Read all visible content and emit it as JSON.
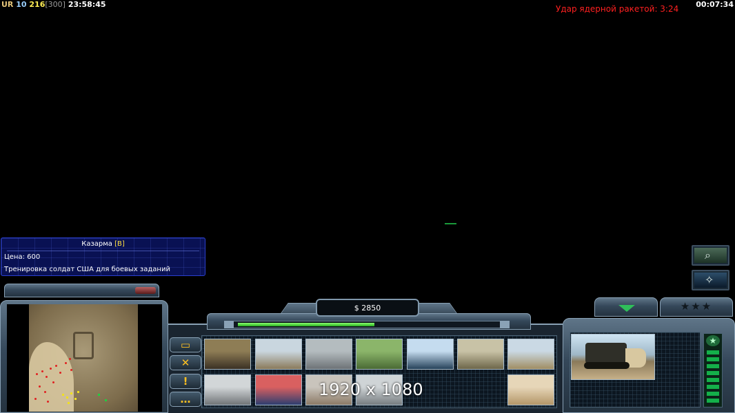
{
  "hud": {
    "faction": "UR",
    "level": "10",
    "units": "216",
    "unit_cap": "[300]",
    "clock": "23:58:45",
    "game_time": "00:07:34",
    "nuke_timer": "Удар ядерной ракетой: 3:24"
  },
  "tooltip": {
    "title": "Казарма",
    "hotkey": "[B]",
    "cost": "Цена: 600",
    "description": "Тренировка солдат США для боевых заданий"
  },
  "resources": {
    "money": "$ 2850",
    "power_level": 0.52
  },
  "overlay": {
    "resolution": "1920 x 1080"
  },
  "tabs": [
    {
      "icon": "structure-icon",
      "glyph": "▭"
    },
    {
      "icon": "tools-icon",
      "glyph": "✕"
    },
    {
      "icon": "alert-icon",
      "glyph": "!"
    },
    {
      "icon": "chat-icon",
      "glyph": "…"
    }
  ],
  "build_buttons": [
    {
      "name": "command-center-button",
      "c1": "#8e7d55",
      "c2": "#3a3024"
    },
    {
      "name": "barracks-button",
      "c1": "#c9d6df",
      "c2": "#8a7a5a"
    },
    {
      "name": "supply-center-button",
      "c1": "#b4bcbf",
      "c2": "#6d7276"
    },
    {
      "name": "airfield-button",
      "c1": "#8bb56a",
      "c2": "#4a6a35"
    },
    {
      "name": "patriot-battery-button",
      "c1": "#c5dcef",
      "c2": "#26425a"
    },
    {
      "name": "war-factory-button",
      "c1": "#c8c2a6",
      "c2": "#6d6649"
    },
    {
      "name": "strategy-center-button",
      "c1": "#cad9e4",
      "c2": "#a08d63"
    },
    {
      "name": "power-plant-button",
      "c1": "#d2d6d8",
      "c2": "#707477"
    },
    {
      "name": "fire-base-button",
      "c1": "#d96060",
      "c2": "#2c3e70"
    },
    {
      "name": "detention-camp-button",
      "c1": "#c9c4bc",
      "c2": "#8c7a66"
    },
    {
      "name": "particle-cannon-button",
      "c1": "#cfd4d6",
      "c2": "#767c80"
    },
    {
      "name": "mine-field-button",
      "c1": "#e6d6b8",
      "c2": "#b49668"
    }
  ],
  "side_buttons": [
    {
      "name": "search-button",
      "glyph": "⌕"
    },
    {
      "name": "satellite-button",
      "glyph": "✧"
    }
  ],
  "rank_stars": "★★★"
}
